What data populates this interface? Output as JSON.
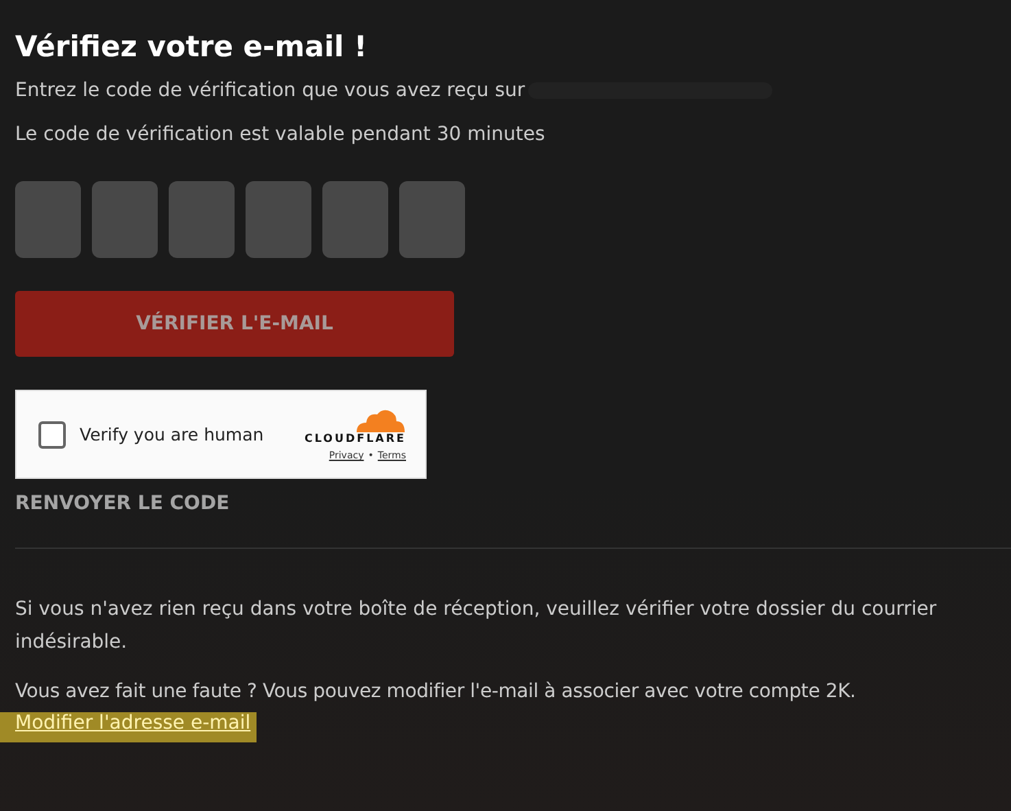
{
  "title": "Vérifiez votre e-mail !",
  "instruction": "Entrez le code de vérification que vous avez reçu sur",
  "validity": "Le code de vérification est valable pendant 30 minutes",
  "code_inputs": [
    {
      "filled": false
    },
    {
      "filled": false
    },
    {
      "filled": false
    },
    {
      "filled": false
    },
    {
      "filled": false
    },
    {
      "filled": false
    }
  ],
  "verify_button": {
    "label": "VÉRIFIER L'E-MAIL",
    "disabled": true
  },
  "captcha": {
    "label": "Verify you are human",
    "checked": false,
    "brand": "CLOUDFLARE",
    "privacy": "Privacy",
    "separator": "•",
    "terms": "Terms"
  },
  "resend": "RENVOYER LE CODE",
  "spam_note": "Si vous n'avez rien reçu dans votre boîte de réception, veuillez vérifier votre dossier du courrier indésirable.",
  "mistake_note": "Vous avez fait une faute ? Vous pouvez modifier l'e-mail à associer avec votre compte 2K.",
  "change_link": {
    "label": "Modifier l'adresse e-mail",
    "focused": true
  }
}
